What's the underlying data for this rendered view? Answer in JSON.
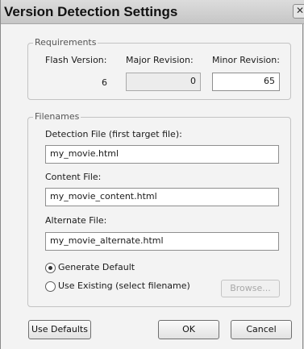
{
  "window": {
    "title": "Version Detection Settings",
    "close_glyph": "✕"
  },
  "requirements": {
    "legend": "Requirements",
    "flash_version_label": "Flash Version:",
    "major_revision_label": "Major Revision:",
    "minor_revision_label": "Minor Revision:",
    "flash_version_value": "6",
    "major_revision_value": "0",
    "minor_revision_value": "65"
  },
  "filenames": {
    "legend": "Filenames",
    "detection_label": "Detection File (first target file):",
    "detection_value": "my_movie.html",
    "content_label": "Content File:",
    "content_value": "my_movie_content.html",
    "alternate_label": "Alternate File:",
    "alternate_value": "my_movie_alternate.html",
    "radio_generate": "Generate Default",
    "radio_existing": "Use Existing (select filename)",
    "selected_option": "Generate Default",
    "browse_label": "Browse..."
  },
  "footer": {
    "use_defaults_label": "Use Defaults",
    "ok_label": "OK",
    "cancel_label": "Cancel"
  }
}
